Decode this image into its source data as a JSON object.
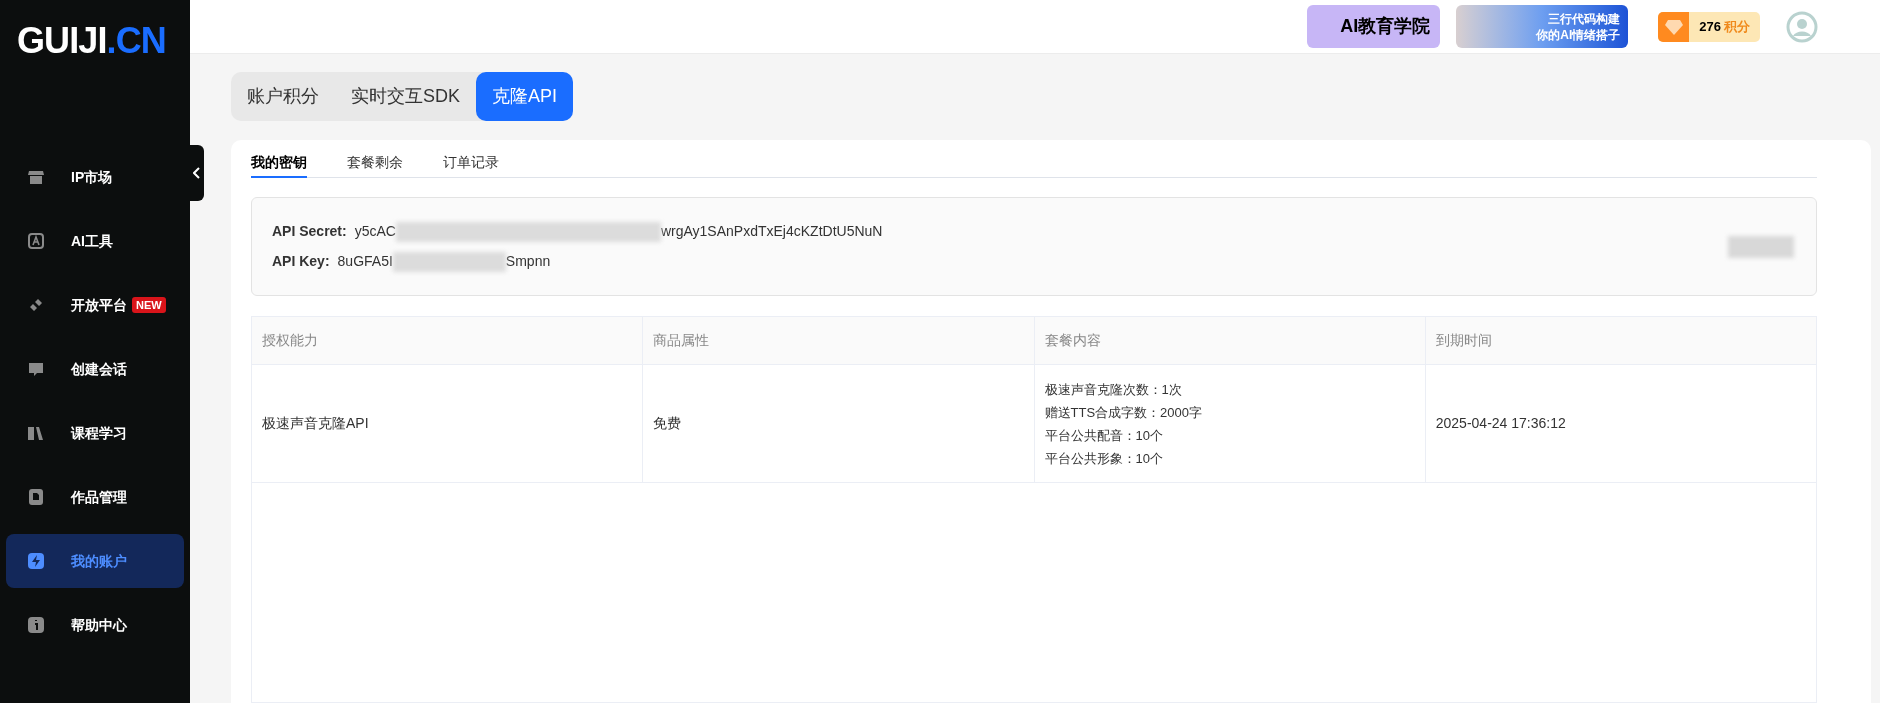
{
  "logo": {
    "main": "GUIJI",
    "accent": ".CN"
  },
  "sidebar": {
    "items": [
      {
        "label": "IP市场",
        "selected": false
      },
      {
        "label": "AI工具",
        "selected": false
      },
      {
        "label": "开放平台",
        "selected": false,
        "badge": "NEW"
      },
      {
        "label": "创建会话",
        "selected": false
      },
      {
        "label": "课程学习",
        "selected": false
      },
      {
        "label": "作品管理",
        "selected": false
      },
      {
        "label": "我的账户",
        "selected": true
      },
      {
        "label": "帮助中心",
        "selected": false
      }
    ]
  },
  "header": {
    "banners": [
      {
        "kind": "academy",
        "text": "AI教育学院"
      },
      {
        "kind": "promo",
        "lines": [
          "三行代码构建",
          "你的AI情绪搭子"
        ]
      }
    ],
    "points": {
      "value": "276",
      "unit": "积分"
    }
  },
  "tabs": [
    {
      "label": "账户积分",
      "selected": false
    },
    {
      "label": "实时交互SDK",
      "selected": false
    },
    {
      "label": "克隆API",
      "selected": true
    }
  ],
  "subtabs": [
    {
      "label": "我的密钥",
      "selected": true
    },
    {
      "label": "套餐剩余",
      "selected": false
    },
    {
      "label": "订单记录",
      "selected": false
    }
  ],
  "keys": [
    {
      "label": "API Secret:",
      "start": "y5cAC",
      "end": "wrgAy1SAnPxdTxEj4cKZtDtU5NuN"
    },
    {
      "label": "API Key:",
      "start": "8uGFA5I",
      "end": "Smpnn"
    }
  ],
  "table": {
    "columns": [
      "授权能力",
      "商品属性",
      "套餐内容",
      "到期时间"
    ],
    "rows": [
      {
        "capability": "极速声音克隆API",
        "attribute": "免费",
        "contents": [
          "极速声音克隆次数：1次",
          "赠送TTS合成字数：2000字",
          "平台公共配音：10个",
          "平台公共形象：10个"
        ],
        "expires": "2025-04-24 17:36:12"
      }
    ]
  }
}
